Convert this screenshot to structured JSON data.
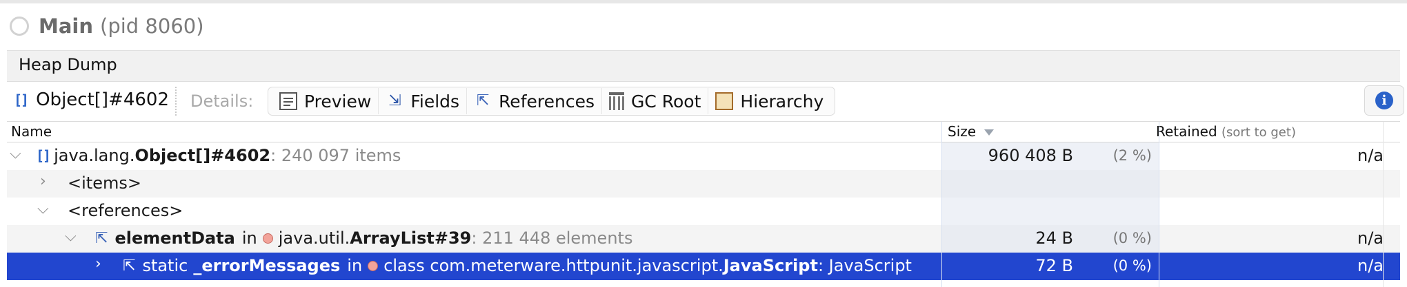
{
  "process": {
    "name": "Main",
    "pid_text": "(pid 8060)"
  },
  "tab": {
    "label": "Heap Dump"
  },
  "toolbar": {
    "object_label": "Object[]#4602",
    "details_label": "Details:",
    "buttons": [
      {
        "label": "Preview",
        "icon": "preview-icon"
      },
      {
        "label": "Fields",
        "icon": "fields-icon"
      },
      {
        "label": "References",
        "icon": "references-icon"
      },
      {
        "label": "GC Root",
        "icon": "gc-root-icon"
      },
      {
        "label": "Hierarchy",
        "icon": "hierarchy-icon"
      }
    ],
    "info_icon": "info-icon"
  },
  "table": {
    "columns": {
      "name": "Name",
      "size": "Size",
      "retained": "Retained",
      "retained_hint": "(sort to get)"
    },
    "rows": [
      {
        "pkg": "java.lang.",
        "name": "Object[]#4602",
        "detail": " : 240 097 items",
        "size": "960 408 B",
        "percent": "(2 %)",
        "retained": "n/a"
      },
      {
        "label": "<items>"
      },
      {
        "label": "<references>"
      },
      {
        "field": "elementData",
        "in": "in",
        "pkg": "java.util.",
        "name": "ArrayList#39",
        "detail": " : 211 448 elements",
        "size": "24 B",
        "percent": "(0 %)",
        "retained": "n/a"
      },
      {
        "prefix": "static ",
        "field": "_errorMessages",
        "in": "in",
        "pkg": "class com.meterware.httpunit.javascript.",
        "name": "JavaScript",
        "detail": " : JavaScript",
        "size": "72 B",
        "percent": "(0 %)",
        "retained": "n/a"
      }
    ]
  },
  "colors": {
    "selection": "#2246cf",
    "accent": "#2b64c8"
  }
}
